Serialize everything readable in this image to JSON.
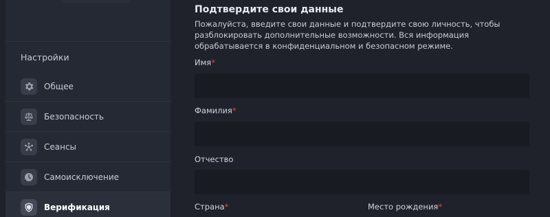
{
  "sidebar": {
    "title": "Настройки",
    "items": [
      {
        "label": "Общее",
        "icon": "gear-icon"
      },
      {
        "label": "Безопасность",
        "icon": "scales-icon"
      },
      {
        "label": "Сеансы",
        "icon": "sessions-icon"
      },
      {
        "label": "Самоисключение",
        "icon": "clock-icon"
      },
      {
        "label": "Верификация",
        "icon": "shield-icon",
        "active": true
      }
    ]
  },
  "form": {
    "title": "Подтвердите свои данные",
    "description": "Пожалуйста, введите свои данные и подтвердите свою личность, чтобы разблокировать дополнительные возможности. Вся информация обрабатывается в конфиденциальном и безопасном режиме.",
    "required_mark": "*",
    "fields": {
      "first_name": {
        "label": "Имя",
        "value": ""
      },
      "last_name": {
        "label": "Фамилия",
        "value": ""
      },
      "patronymic": {
        "label": "Отчество",
        "value": ""
      },
      "country": {
        "label": "Страна"
      },
      "birthplace": {
        "label": "Место рождения"
      }
    }
  },
  "colors": {
    "background": "#1f222b",
    "sidebar": "#252933",
    "input": "#181b22",
    "required": "#e04848"
  }
}
